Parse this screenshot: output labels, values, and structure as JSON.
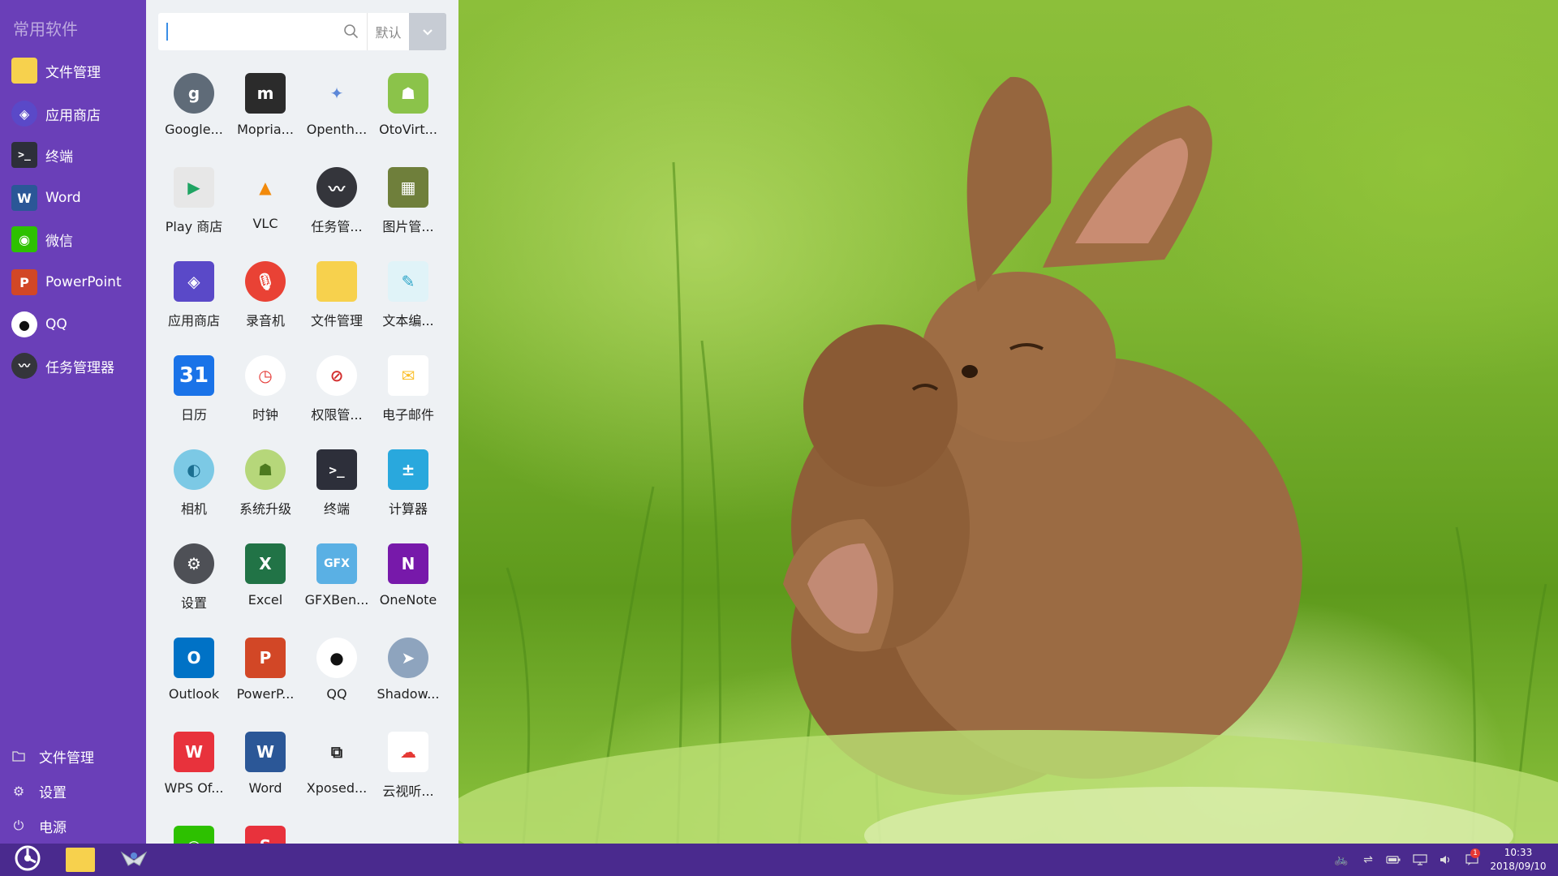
{
  "sidebar": {
    "title": "常用软件",
    "items": [
      {
        "label": "文件管理",
        "icon": "folder-icon"
      },
      {
        "label": "应用商店",
        "icon": "app-store-icon"
      },
      {
        "label": "终端",
        "icon": "terminal-icon"
      },
      {
        "label": "Word",
        "icon": "word-icon"
      },
      {
        "label": "微信",
        "icon": "wechat-icon"
      },
      {
        "label": "PowerPoint",
        "icon": "powerpoint-icon"
      },
      {
        "label": "QQ",
        "icon": "qq-icon"
      },
      {
        "label": "任务管理器",
        "icon": "task-manager-icon"
      }
    ],
    "bottom": [
      {
        "label": "文件管理",
        "icon": "folder-outline-icon"
      },
      {
        "label": "设置",
        "icon": "gear-icon"
      },
      {
        "label": "电源",
        "icon": "power-icon"
      }
    ]
  },
  "drawer": {
    "search": {
      "value": "",
      "placeholder": ""
    },
    "sort_label": "默认",
    "apps": [
      {
        "label": "Google...",
        "icon": "google-settings-icon"
      },
      {
        "label": "Mopria...",
        "icon": "mopria-icon"
      },
      {
        "label": "Openth...",
        "icon": "openthos-icon"
      },
      {
        "label": "OtoVirt...",
        "icon": "android-icon"
      },
      {
        "label": "Play 商店",
        "icon": "play-store-icon"
      },
      {
        "label": "VLC",
        "icon": "vlc-icon"
      },
      {
        "label": "任务管...",
        "icon": "task-manager-icon"
      },
      {
        "label": "图片管...",
        "icon": "gallery-icon"
      },
      {
        "label": "应用商店",
        "icon": "app-store-icon"
      },
      {
        "label": "录音机",
        "icon": "microphone-icon"
      },
      {
        "label": "文件管理",
        "icon": "folder-icon"
      },
      {
        "label": "文本编...",
        "icon": "text-editor-icon"
      },
      {
        "label": "日历",
        "icon": "calendar-icon",
        "text": "31"
      },
      {
        "label": "时钟",
        "icon": "clock-icon"
      },
      {
        "label": "权限管...",
        "icon": "permission-icon"
      },
      {
        "label": "电子邮件",
        "icon": "email-icon"
      },
      {
        "label": "相机",
        "icon": "camera-icon"
      },
      {
        "label": "系统升级",
        "icon": "system-update-icon"
      },
      {
        "label": "终端",
        "icon": "terminal-icon"
      },
      {
        "label": "计算器",
        "icon": "calculator-icon"
      },
      {
        "label": "设置",
        "icon": "settings-icon"
      },
      {
        "label": "Excel",
        "icon": "excel-icon"
      },
      {
        "label": "GFXBen...",
        "icon": "gfxbench-icon",
        "text": "GFX"
      },
      {
        "label": "OneNote",
        "icon": "onenote-icon"
      },
      {
        "label": "Outlook",
        "icon": "outlook-icon"
      },
      {
        "label": "PowerP...",
        "icon": "powerpoint-icon"
      },
      {
        "label": "QQ",
        "icon": "qq-icon"
      },
      {
        "label": "Shadow...",
        "icon": "shadowsocks-icon"
      },
      {
        "label": "WPS Of...",
        "icon": "wps-icon"
      },
      {
        "label": "Word",
        "icon": "word-icon"
      },
      {
        "label": "Xposed...",
        "icon": "xposed-icon"
      },
      {
        "label": "云视听...",
        "icon": "cloud-tv-icon"
      },
      {
        "label": "",
        "icon": "wechat-icon"
      },
      {
        "label": "",
        "icon": "wps-red-icon"
      }
    ]
  },
  "taskbar": {
    "pinned": [
      {
        "icon": "start-menu-icon"
      },
      {
        "icon": "folder-icon"
      },
      {
        "icon": "openthos-icon"
      }
    ],
    "tray": [
      "bike-icon",
      "usb-icon",
      "battery-icon",
      "display-icon",
      "volume-icon",
      "notification-icon"
    ],
    "notification_count": "1",
    "time": "10:33",
    "date": "2018/09/10"
  },
  "colors": {
    "sidebar": "#6a3fb8",
    "taskbar": "#4a2a8e",
    "drawer": "#eef1f4"
  }
}
